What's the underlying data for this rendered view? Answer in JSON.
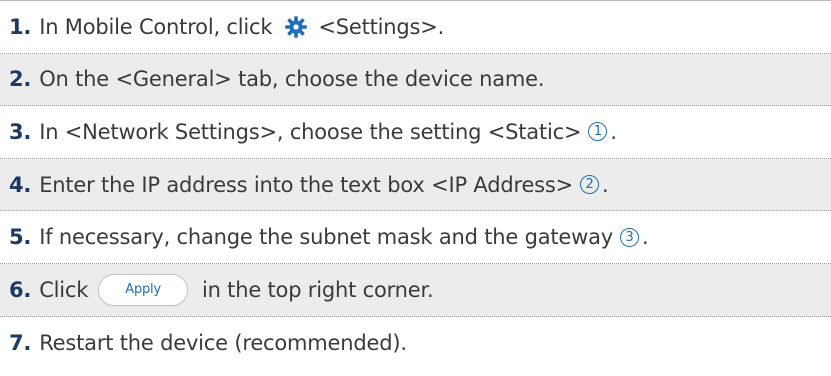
{
  "steps": [
    {
      "num": "1.",
      "before": "In Mobile Control, click",
      "after": "<Settings>."
    },
    {
      "num": "2.",
      "text": "On the <General> tab, choose the device name."
    },
    {
      "num": "3.",
      "text": "In <Network Settings>, choose the setting <Static>",
      "marker": "1",
      "end": "."
    },
    {
      "num": "4.",
      "text": "Enter the IP address into the text box <IP Address>",
      "marker": "2",
      "end": "."
    },
    {
      "num": "5.",
      "text": "If necessary, change the subnet mask and the gateway",
      "marker": "3",
      "end": "."
    },
    {
      "num": "6.",
      "before": "Click",
      "button": "Apply",
      "after": "in the top right corner."
    },
    {
      "num": "7.",
      "text": "Restart the device (recommended)."
    }
  ],
  "colors": {
    "number": "#1c3a66",
    "accent": "#1f6fb8",
    "gear": "#1f6fb8",
    "shaded_row": "#ececec"
  },
  "icons": {
    "settings": "gear-icon"
  }
}
